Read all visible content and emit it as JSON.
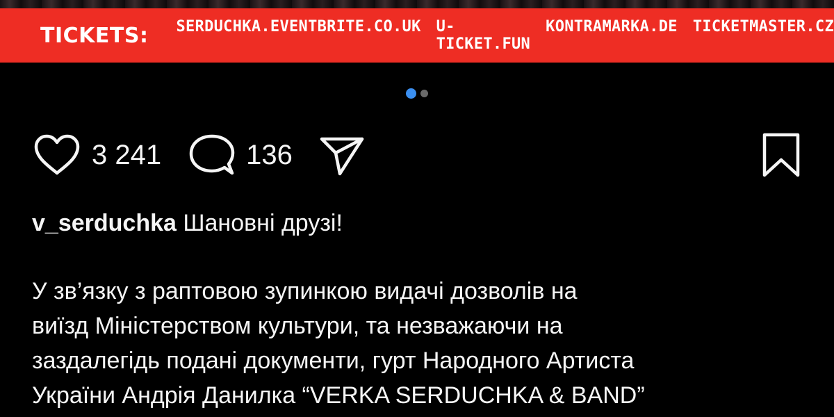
{
  "banner": {
    "label": "TICKETS:",
    "links": [
      "SERDUCHKA.EVENTBRITE.CO.UK",
      "U-TICKET.FUN",
      "KONTRAMARKA.DE",
      "TICKETMASTER.CZ"
    ],
    "background_color": "#ee2d24"
  },
  "carousel": {
    "total": 2,
    "active_index": 0,
    "active_color": "#3b8ff0"
  },
  "actions": {
    "likes_icon": "heart-icon",
    "likes_count": "3 241",
    "comments_icon": "comment-bubble-icon",
    "comments_count": "136",
    "share_icon": "paper-plane-icon",
    "save_icon": "bookmark-icon"
  },
  "post": {
    "username": "v_serduchka",
    "greeting": "Шановні друзі!",
    "lines": [
      "У зв’язку з раптовою зупинкою видачі дозволів на",
      "виїзд Міністерством культури, та незважаючи на",
      "заздалегідь подані документи, гурт Народного Артиста",
      "України Андрія Данилка “VERKA SERDUCHKA & BAND”"
    ]
  }
}
